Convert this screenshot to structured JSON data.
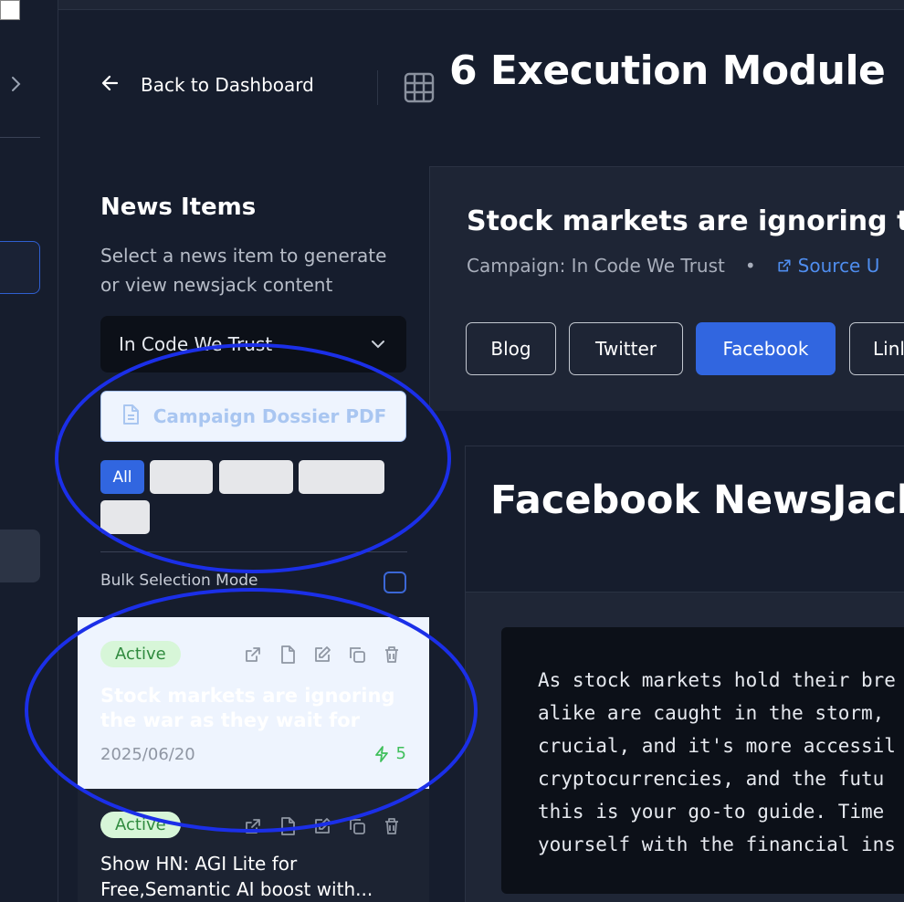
{
  "header": {
    "back_label": "Back to Dashboard",
    "title": "6 Execution Module"
  },
  "sidebar_panel": {
    "heading": "News Items",
    "subtitle": "Select a news item to generate or view newsjack content",
    "campaign_select": "In Code We Trust",
    "dossier_button": "Campaign Dossier PDF",
    "filter_all": "All",
    "bulk_label": "Bulk Selection Mode"
  },
  "news_items": [
    {
      "status": "Active",
      "title": "Stock markets are ignoring the war as they wait for the...",
      "date": "2025/06/20",
      "count": "5"
    },
    {
      "status": "Active",
      "title": "Show HN: AGI Lite for Free,Semantic AI boost with..."
    }
  ],
  "detail": {
    "title": "Stock markets are ignoring th",
    "campaign": "Campaign: In Code We Trust",
    "separator": "•",
    "source_label": "Source U",
    "tabs": [
      {
        "label": "Blog"
      },
      {
        "label": "Twitter"
      },
      {
        "label": "Facebook"
      },
      {
        "label": "Linl"
      }
    ]
  },
  "content_card": {
    "title": "Facebook NewsJack",
    "lines": [
      "As stock markets hold their bre",
      "alike are caught in the storm,",
      "crucial, and it's more accessil",
      "cryptocurrencies, and the futu",
      "this is your go-to guide. Time",
      "yourself with the financial ins"
    ]
  },
  "colors": {
    "accent": "#3166e0",
    "annotation": "#1b2fe8",
    "active_badge": "#d7f6d8"
  }
}
